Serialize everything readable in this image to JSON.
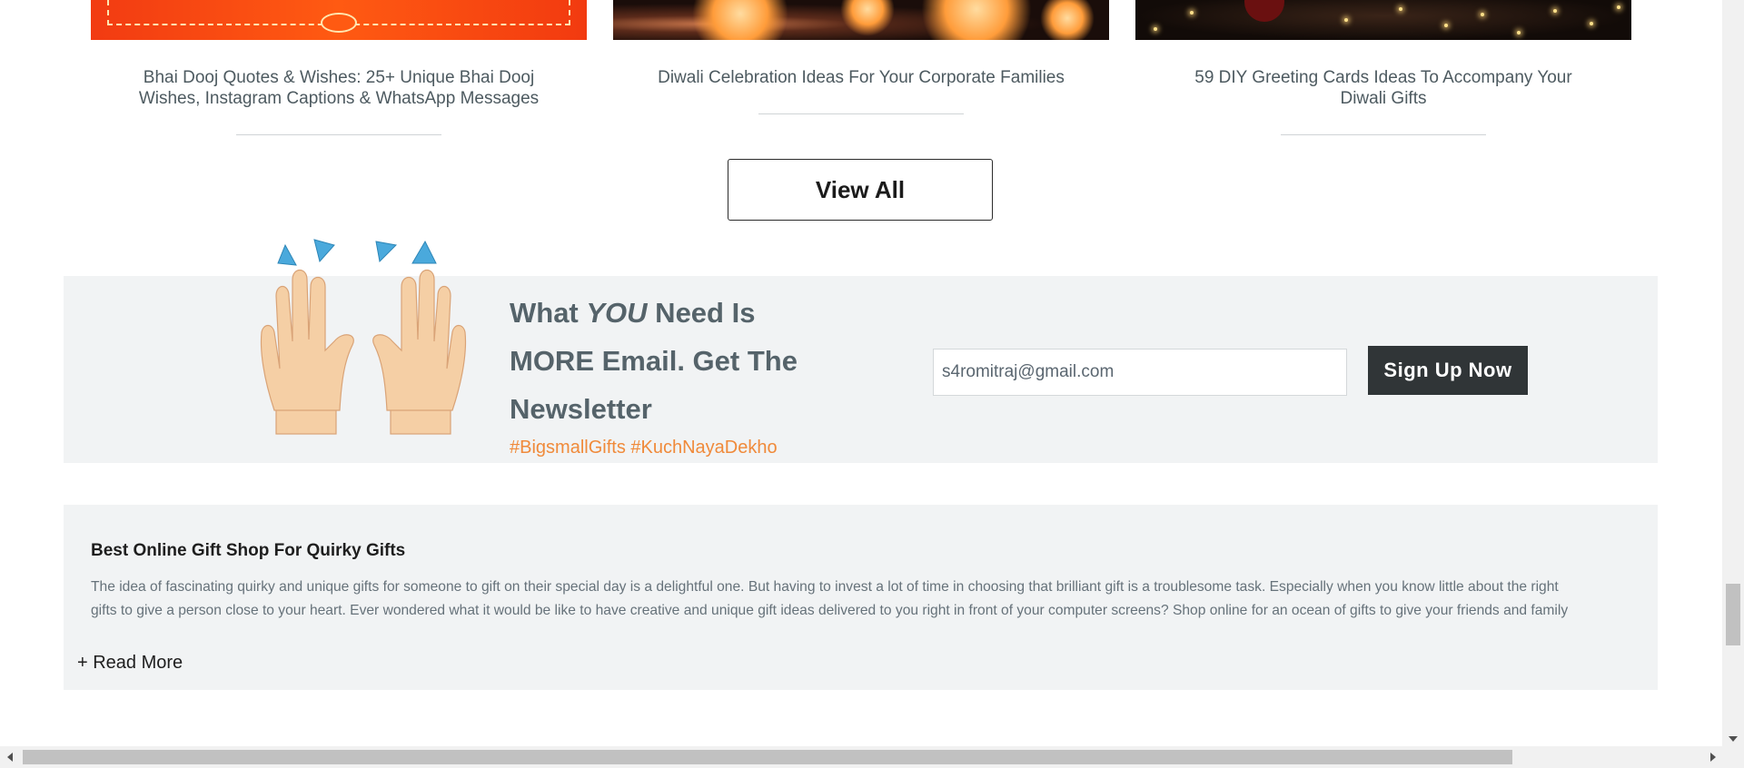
{
  "blog_cards": [
    {
      "title": "Bhai Dooj Quotes & Wishes: 25+ Unique Bhai Dooj Wishes, Instagram Captions & WhatsApp Messages",
      "image_theme": "red-ornamental"
    },
    {
      "title": "Diwali Celebration Ideas For Your Corporate Families",
      "image_theme": "candles-dark"
    },
    {
      "title": "59 DIY Greeting Cards Ideas To Accompany Your Diwali Gifts",
      "image_theme": "fairy-lights-dark"
    }
  ],
  "view_all_label": "View All",
  "newsletter": {
    "heading_part1": "What ",
    "heading_emphasis": "YOU",
    "heading_part2": " Need Is MORE Email. Get The Newsletter",
    "hashtags": "#BigsmallGifts #KuchNayaDekho",
    "email_value": "s4romitraj@gmail.com",
    "button_label": "Sign Up Now",
    "icon": "raising-hands-emoji"
  },
  "seo": {
    "title": "Best Online Gift Shop For Quirky Gifts",
    "line1": "The idea of fascinating quirky and unique gifts for someone to gift on their special day is a delightful one. But having to invest a lot of time in choosing that brilliant gift is a troublesome task. Especially when you know little about the right",
    "line2": "gifts to give a person close to your heart. Ever wondered what it would be like to have creative and unique gift ideas delivered to you right in front of your computer screens? Shop online for an ocean of gifts to give your friends and family",
    "read_more_label": "+ Read More"
  },
  "colors": {
    "text_heading": "#55636a",
    "hashtag": "#f08a3a",
    "button_dark": "#303537",
    "panel_bg": "#f1f3f4"
  }
}
